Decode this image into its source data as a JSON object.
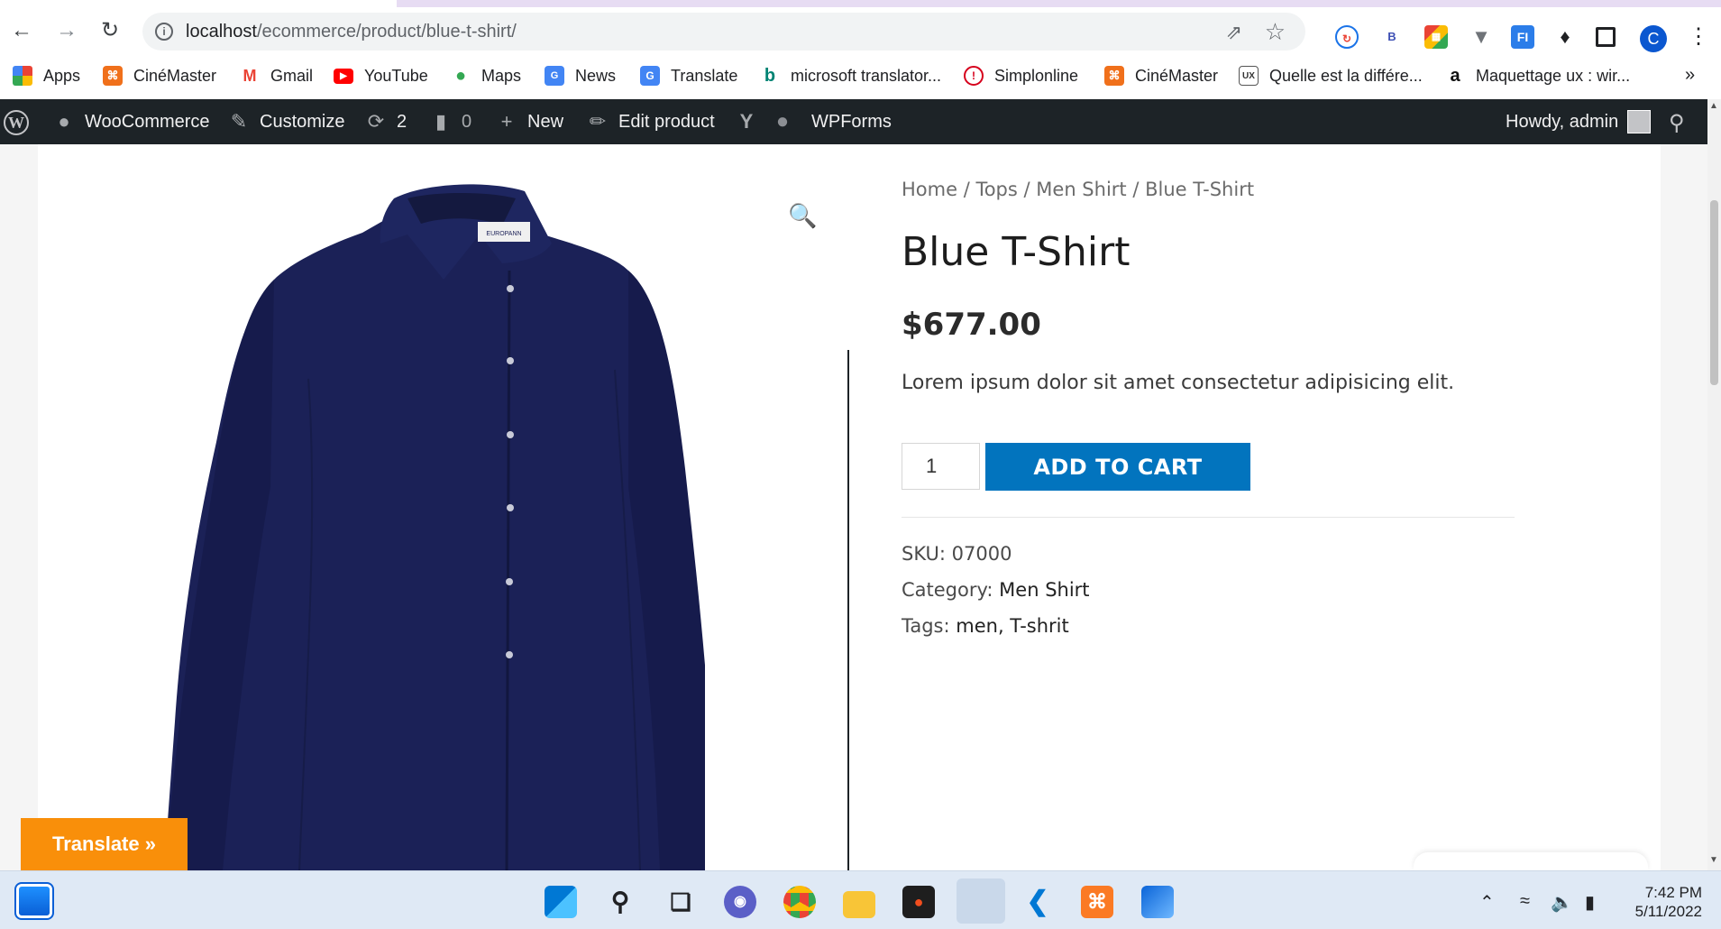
{
  "browser": {
    "url_host": "localhost",
    "url_path": "/ecommerce/product/blue-t-shirt/",
    "profile_initial": "C",
    "bookmarks": [
      {
        "label": "Apps",
        "icon": "apps-grid-icon",
        "color": "#ea4335"
      },
      {
        "label": "CinéMaster",
        "icon": "xampp-icon",
        "color": "#f0701b"
      },
      {
        "label": "Gmail",
        "icon": "gmail-icon",
        "color": "#ea4335"
      },
      {
        "label": "YouTube",
        "icon": "youtube-icon",
        "color": "#ff0000"
      },
      {
        "label": "Maps",
        "icon": "maps-pin-icon",
        "color": "#34a853"
      },
      {
        "label": "News",
        "icon": "google-news-icon",
        "color": "#4285f4"
      },
      {
        "label": "Translate",
        "icon": "google-translate-icon",
        "color": "#4285f4"
      },
      {
        "label": "microsoft translator...",
        "icon": "bing-icon",
        "color": "#008373"
      },
      {
        "label": "Simplonline",
        "icon": "simplon-icon",
        "color": "#d6001c"
      },
      {
        "label": "CinéMaster",
        "icon": "xampp-icon",
        "color": "#f0701b"
      },
      {
        "label": "Quelle est la différe...",
        "icon": "blog-ux-icon",
        "color": "#555555"
      },
      {
        "label": "Maquettage ux : wir...",
        "icon": "amazon-a-icon",
        "color": "#111111"
      }
    ],
    "more_label": "»"
  },
  "adminbar": {
    "woocommerce": "WooCommerce",
    "customize": "Customize",
    "updates_count": "2",
    "comments_count": "0",
    "new": "New",
    "edit_product": "Edit product",
    "wpforms": "WPForms",
    "howdy": "Howdy, admin"
  },
  "product": {
    "breadcrumb": [
      "Home",
      "Tops",
      "Men Shirt",
      "Blue T-Shirt"
    ],
    "title": "Blue T-Shirt",
    "price": "$677.00",
    "short_description": "Lorem ipsum dolor sit amet consectetur adipisicing elit.",
    "quantity": "1",
    "add_to_cart": "ADD TO CART",
    "sku_label": "SKU:",
    "sku": "07000",
    "category_label": "Category:",
    "category": "Men Shirt",
    "tags_label": "Tags:",
    "tags": "men, T-shrit",
    "shirt_label": "EUROPANN",
    "shirt_color": "#1b2157"
  },
  "translate_widget": {
    "label": "Translate »",
    "color": "#f98f0a"
  },
  "taskbar": {
    "time": "7:42 PM",
    "date": "5/11/2022",
    "apps": [
      "start-icon",
      "search-icon",
      "task-view-icon",
      "teams-chat-icon",
      "chrome-icon",
      "file-explorer-icon",
      "figma-icon",
      "chrome-profile-icon",
      "vscode-icon",
      "xampp-icon",
      "photos-icon"
    ]
  },
  "colors": {
    "accent": "#0274be",
    "admin_bar": "#1d2327"
  }
}
